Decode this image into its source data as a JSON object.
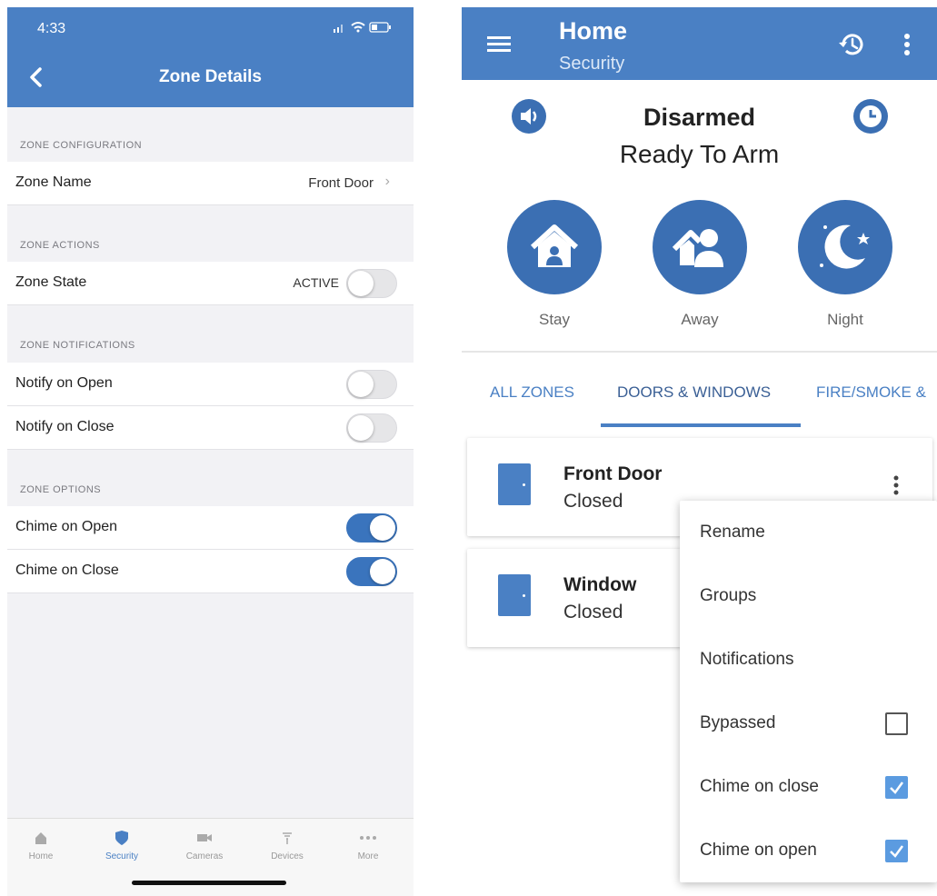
{
  "ios": {
    "status_time": "4:33",
    "status_icons": "signal wifi battery",
    "title": "Zone Details",
    "sections": {
      "configuration": "ZONE CONFIGURATION",
      "actions": "ZONE ACTIONS",
      "notifications": "ZONE NOTIFICATIONS",
      "options": "ZONE OPTIONS"
    },
    "zone_name": {
      "label": "Zone Name",
      "value": "Front Door"
    },
    "zone_state": {
      "label": "Zone State",
      "value": "ACTIVE",
      "on": false
    },
    "notify_open": {
      "label": "Notify on Open",
      "on": false
    },
    "notify_close": {
      "label": "Notify on Close",
      "on": false
    },
    "chime_open": {
      "label": "Chime on Open",
      "on": true
    },
    "chime_close": {
      "label": "Chime on Close",
      "on": true
    },
    "tabs": [
      {
        "label": "Home",
        "icon": "home-icon"
      },
      {
        "label": "Security",
        "icon": "shield-icon",
        "active": true
      },
      {
        "label": "Cameras",
        "icon": "camera-icon"
      },
      {
        "label": "Devices",
        "icon": "devices-icon"
      },
      {
        "label": "More",
        "icon": "more-dots-icon"
      }
    ],
    "accent": "#4a80c4"
  },
  "android": {
    "title": "Home",
    "subtitle": "Security",
    "status": "Disarmed",
    "status_sub": "Ready To Arm",
    "arm_modes": [
      {
        "label": "Stay",
        "icon": "house-icon"
      },
      {
        "label": "Away",
        "icon": "people-house-icon"
      },
      {
        "label": "Night",
        "icon": "moon-stars-icon"
      }
    ],
    "zone_tabs": [
      {
        "label": "ALL ZONES"
      },
      {
        "label": "DOORS & WINDOWS",
        "active": true
      },
      {
        "label": "FIRE/SMOKE &"
      }
    ],
    "zones": [
      {
        "name": "Front Door",
        "state": "Closed"
      },
      {
        "name": "Window",
        "state": "Closed"
      }
    ],
    "menu": {
      "rename": "Rename",
      "groups": "Groups",
      "notifications": "Notifications",
      "bypassed": {
        "label": "Bypassed",
        "checked": false
      },
      "chime_close": {
        "label": "Chime on close",
        "checked": true
      },
      "chime_open": {
        "label": "Chime on open",
        "checked": true
      }
    },
    "accent": "#4a80c4"
  }
}
